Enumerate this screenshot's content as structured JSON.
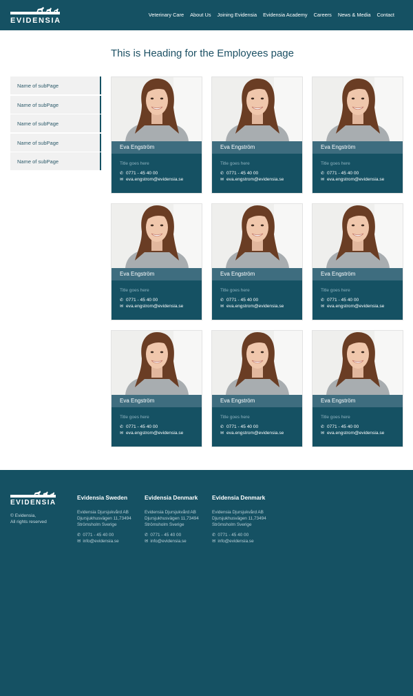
{
  "header": {
    "logo_text": "EVIDENSIA",
    "nav": [
      "Veterinary Care",
      "About Us",
      "Joining Evidensia",
      "Evidensia Academy",
      "Careers",
      "News & Media",
      "Contact"
    ]
  },
  "main": {
    "title": "This is Heading for the Employees page"
  },
  "sidebar": {
    "items": [
      "Name of subPage",
      "Name of subPage",
      "Name of subPage",
      "Name of subPage",
      "Name of subPage"
    ]
  },
  "employees": [
    {
      "name": "Eva Engström",
      "title": "Title goes here",
      "phone": "0771 - 45 40 00",
      "email": "eva.engstrom@evidensia.se"
    },
    {
      "name": "Eva Engström",
      "title": "Title goes here",
      "phone": "0771 - 45 40 00",
      "email": "eva.engstrom@evidensia.se"
    },
    {
      "name": "Eva Engström",
      "title": "Title goes here",
      "phone": "0771 - 45 40 00",
      "email": "eva.engstrom@evidensia.se"
    },
    {
      "name": "Eva Engström",
      "title": "Title goes here",
      "phone": "0771 - 45 40 00",
      "email": "eva.engstrom@evidensia.se"
    },
    {
      "name": "Eva Engström",
      "title": "Title goes here",
      "phone": "0771 - 45 40 00",
      "email": "eva.engstrom@evidensia.se"
    },
    {
      "name": "Eva Engström",
      "title": "Title goes here",
      "phone": "0771 - 45 40 00",
      "email": "eva.engstrom@evidensia.se"
    },
    {
      "name": "Eva Engström",
      "title": "Title goes here",
      "phone": "0771 - 45 40 00",
      "email": "eva.engstrom@evidensia.se"
    },
    {
      "name": "Eva Engström",
      "title": "Title goes here",
      "phone": "0771 - 45 40 00",
      "email": "eva.engstrom@evidensia.se"
    },
    {
      "name": "Eva Engström",
      "title": "Title goes here",
      "phone": "0771 - 45 40 00",
      "email": "eva.engstrom@evidensia.se"
    }
  ],
  "footer": {
    "logo_text": "EVIDENSIA",
    "copyright_line1": "© Evidensia,",
    "copyright_line2": "All rights reserved",
    "columns": [
      {
        "heading": "Evidensia Sweden",
        "addr1": "Evidensia Djursjukvård AB",
        "addr2": "Djursjukhusvägen 11,73494",
        "addr3": "Strömsholm Sverige",
        "phone": "0771 - 45 40 00",
        "email": "info@evidensia.se"
      },
      {
        "heading": "Evidensia Denmark",
        "addr1": "Evidensia Djursjukvård AB",
        "addr2": "Djursjukhusvägen 11,73494",
        "addr3": "Strömsholm Sverige",
        "phone": "0771 - 45 40 00",
        "email": "info@evidensia.se"
      },
      {
        "heading": "Evidensia Denmark",
        "addr1": "Evidensia Djursjukvård AB",
        "addr2": "Djursjukhusvägen 11,73494",
        "addr3": "Strömsholm Sverige",
        "phone": "0771 - 45 40 00",
        "email": "info@evidensia.se"
      }
    ]
  },
  "colors": {
    "brand_dark": "#155163",
    "name_bar": "#3e6d7f",
    "sidebar_bg": "#f1f1f1"
  },
  "icons": [
    "phone-icon",
    "mail-icon",
    "animals-logo-icon"
  ]
}
